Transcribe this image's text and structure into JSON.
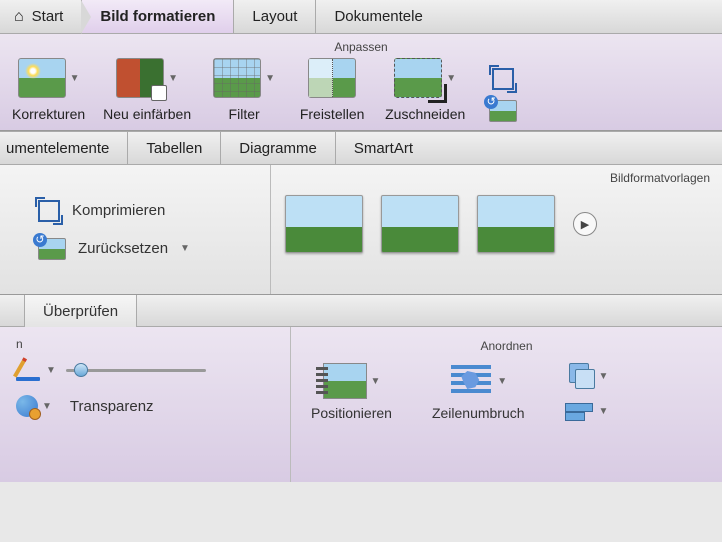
{
  "tabs1": {
    "start": "Start",
    "bild": "Bild formatieren",
    "layout": "Layout",
    "dokumentelemente": "Dokumentele"
  },
  "anpassen": {
    "title": "Anpassen",
    "korrekturen": "Korrekturen",
    "neu_einfarben": "Neu einfärben",
    "filter": "Filter",
    "freistellen": "Freistellen",
    "zuschneiden": "Zuschneiden"
  },
  "tabs2": {
    "umentelemente": "umentelemente",
    "tabellen": "Tabellen",
    "diagramme": "Diagramme",
    "smartart": "SmartArt"
  },
  "panel2": {
    "bildformatvorlagen": "Bildformatvorlagen",
    "komprimieren": "Komprimieren",
    "zuruecksetzen": "Zurücksetzen"
  },
  "tabs3": {
    "ueberpruefen": "Überprüfen"
  },
  "panel3": {
    "left_title": "n",
    "transparenz": "Transparenz",
    "anordnen_title": "Anordnen",
    "positionieren": "Positionieren",
    "zeilenumbruch": "Zeilenumbruch"
  }
}
